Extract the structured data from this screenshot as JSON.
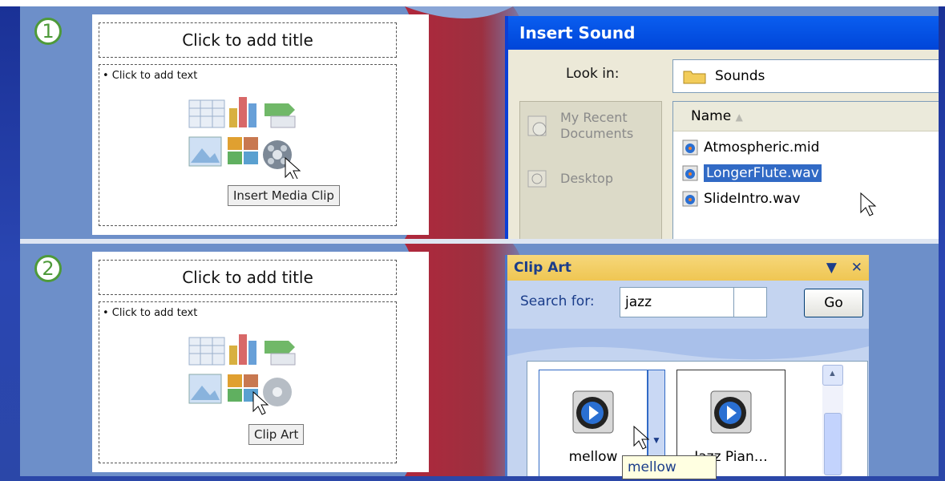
{
  "steps": [
    {
      "number": "1",
      "slide": {
        "title_placeholder": "Click to add title",
        "bullet_text": "• Click to add text",
        "tooltip": "Insert Media Clip"
      },
      "dialog": {
        "title": "Insert Sound",
        "look_in_label": "Look in:",
        "look_in_value": "Sounds",
        "places": [
          "My Recent Documents",
          "Desktop"
        ],
        "column_header": "Name",
        "files": [
          {
            "name": "Atmospheric.mid",
            "selected": false
          },
          {
            "name": "LongerFlute.wav",
            "selected": true
          },
          {
            "name": "SlideIntro.wav",
            "selected": false
          }
        ]
      }
    },
    {
      "number": "2",
      "slide": {
        "title_placeholder": "Click to add title",
        "bullet_text": "• Click to add text",
        "tooltip": "Clip Art"
      },
      "pane": {
        "title": "Clip Art",
        "dropdown_icon": "▼",
        "close_icon": "✕",
        "search_label": "Search for:",
        "search_value": "jazz",
        "go_label": "Go",
        "results": [
          "mellow",
          "Jazz Pian…"
        ],
        "hover_tooltip": "mellow"
      }
    }
  ],
  "colors": {
    "panel": "#6d8fc9",
    "ribbon": "#b0273b",
    "selection": "#316ac5",
    "step_ring": "#4e9a3a"
  }
}
